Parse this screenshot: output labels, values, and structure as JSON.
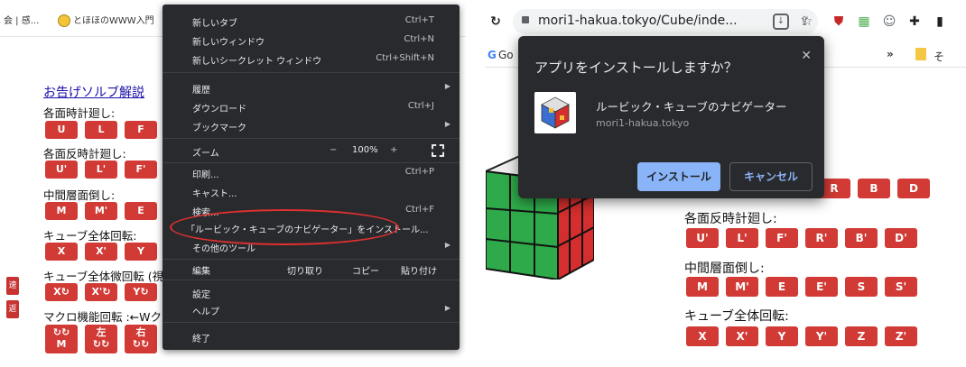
{
  "left": {
    "bookmarks": {
      "tab_fragment": "会 | 感...",
      "bookmark_label": "とほほのWWW入門"
    },
    "page_link": "お告げソルブ解説",
    "rows": [
      {
        "label": "各面時計廻し:",
        "buttons": [
          "U",
          "L",
          "F"
        ]
      },
      {
        "label": "各面反時計廻し:",
        "buttons": [
          "U'",
          "L'",
          "F'"
        ]
      },
      {
        "label": "中間層面倒し:",
        "buttons": [
          "M",
          "M'",
          "E"
        ]
      },
      {
        "label": "キューブ全体回転:",
        "buttons": [
          "X",
          "X'",
          "Y"
        ]
      },
      {
        "label": "キューブ全体微回転 (視",
        "buttons": [
          "X↻",
          "X'↻",
          "Y↻"
        ]
      },
      {
        "label": "マクロ機能回転 :←Wク",
        "buttons": [
          "↻↻\nM",
          "左\n↻↻",
          "右\n↻↻"
        ]
      }
    ],
    "side_buttons": [
      "速",
      "返"
    ],
    "menu": {
      "new_tab": "新しいタブ",
      "new_tab_sc": "Ctrl+T",
      "new_window": "新しいウィンドウ",
      "new_window_sc": "Ctrl+N",
      "incognito": "新しいシークレット ウィンドウ",
      "incognito_sc": "Ctrl+Shift+N",
      "history": "履歴",
      "downloads": "ダウンロード",
      "downloads_sc": "Ctrl+J",
      "bookmarks": "ブックマーク",
      "zoom": "ズーム",
      "zoom_minus": "−",
      "zoom_value": "100%",
      "zoom_plus": "+",
      "print": "印刷...",
      "print_sc": "Ctrl+P",
      "cast": "キャスト...",
      "find": "検索...",
      "find_sc": "Ctrl+F",
      "install": "「ルービック・キューブのナビゲーター」をインストール...",
      "more_tools": "その他のツール",
      "edit": "編集",
      "cut": "切り取り",
      "copy": "コピー",
      "paste": "貼り付け",
      "settings": "設定",
      "help": "ヘルプ",
      "exit": "終了"
    }
  },
  "right": {
    "url": "mori1-hakua.tokyo/Cube/inde...",
    "bookmark_fragment": "Go",
    "bookmark_more": "»",
    "bookmark_tail": "そ",
    "dialog": {
      "title": "アプリをインストールしますか？",
      "app_name": "ルービック・キューブのナビゲーター",
      "app_origin": "mori1-hakua.tokyo",
      "install": "インストール",
      "cancel": "キャンセル"
    },
    "row0_buttons": [
      "R",
      "B",
      "D"
    ],
    "rows": [
      {
        "label": "各面反時計廻し:",
        "buttons": [
          "U'",
          "L'",
          "F'",
          "R'",
          "B'",
          "D'"
        ]
      },
      {
        "label": "中間層面倒し:",
        "buttons": [
          "M",
          "M'",
          "E",
          "E'",
          "S",
          "S'"
        ]
      },
      {
        "label": "キューブ全体回転:",
        "buttons": [
          "X",
          "X'",
          "Y",
          "Y'",
          "Z",
          "Z'"
        ]
      }
    ]
  }
}
